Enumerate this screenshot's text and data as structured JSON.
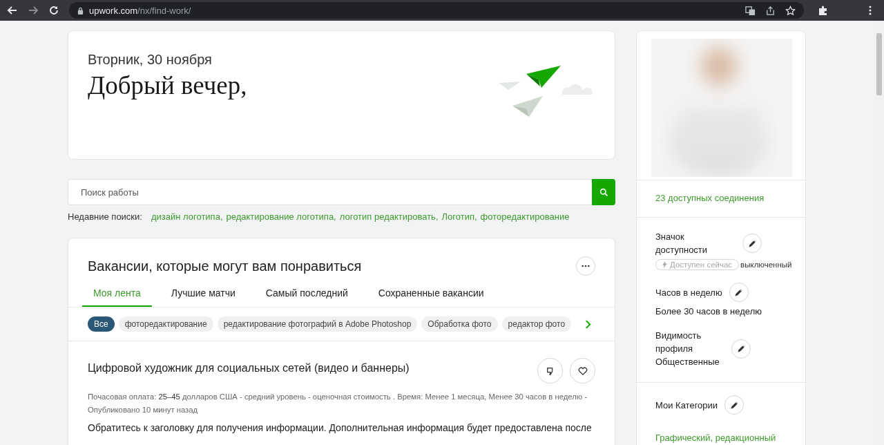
{
  "browser": {
    "url_host": "upwork.com",
    "url_path": "/nx/find-work/"
  },
  "greeting": {
    "date": "Вторник, 30 ноября",
    "title": "Добрый вечер,"
  },
  "search": {
    "placeholder": "Поиск работы"
  },
  "recent_searches": {
    "label": "Недавние поиски:",
    "items": [
      "дизайн логотипа,",
      "редактирование логотипа,",
      "логотип редактировать,",
      "Логотип,",
      "фоторедактирование"
    ]
  },
  "jobs": {
    "title": "Вакансии, которые могут вам понравиться",
    "tabs": [
      {
        "label": "Моя лента",
        "selected": true
      },
      {
        "label": "Лучшие матчи",
        "selected": false
      },
      {
        "label": "Самый последний",
        "selected": false
      },
      {
        "label": "Сохраненные вакансии",
        "selected": false
      }
    ],
    "filters": [
      {
        "label": "Все",
        "selected": true
      },
      {
        "label": "фоторедактирование",
        "selected": false
      },
      {
        "label": "редактирование фотографий в Adobe Photoshop",
        "selected": false
      },
      {
        "label": "Обработка фото",
        "selected": false
      },
      {
        "label": "редактор фото",
        "selected": false
      }
    ],
    "job": {
      "title": "Цифровой художник для социальных сетей (видео и баннеры)",
      "details": "Почасовая оплата: **25–45** долларов США - средний уровень - оценочная стоимость . Время: Менее 1 месяца, Менее 30 часов в неделю - Опубликовано 10 минут назад",
      "description": "Обратитесь к заголовку для получения информации. Дополнительная информация будет предоставлена после"
    }
  },
  "sidebar": {
    "connects": "23 доступных соединения",
    "availability": {
      "label": "Значок доступности",
      "badge": "Доступен сейчас",
      "available": false,
      "status": "выключенный"
    },
    "hours": {
      "label": "Часов в неделю",
      "value": "Более 30 часов в неделю"
    },
    "visibility": {
      "label": "Видимость профиля",
      "value": "Общественные"
    },
    "categories": {
      "label": "Мои Категории",
      "value": "Графический, редакционный"
    }
  }
}
